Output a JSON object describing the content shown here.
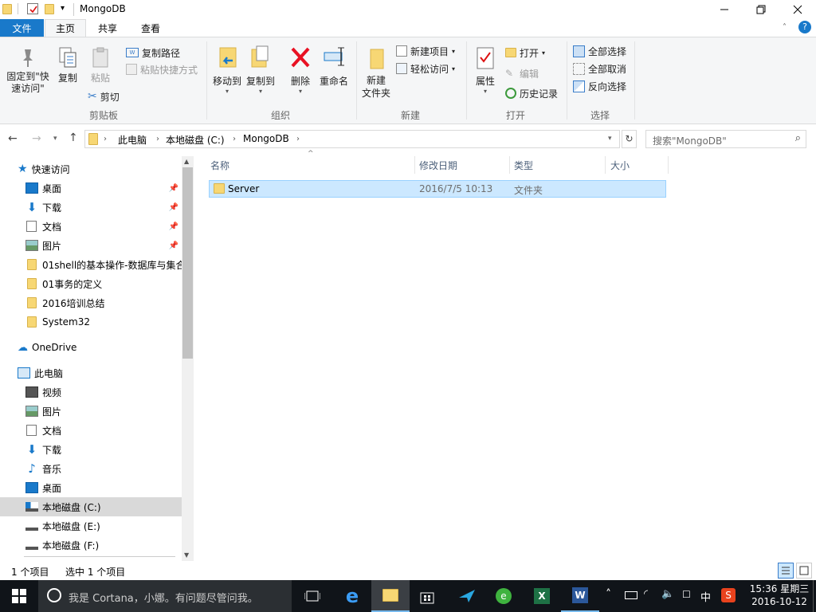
{
  "window": {
    "title": "MongoDB"
  },
  "ribbon_tabs": [
    "文件",
    "主页",
    "共享",
    "查看"
  ],
  "ribbon": {
    "clipboard": {
      "pin_label": "固定到\"快\n速访问\"",
      "copy_label": "复制",
      "paste_label": "粘贴",
      "copy_path_label": "复制路径",
      "paste_shortcut_label": "粘贴快捷方式",
      "cut_label": "剪切",
      "group_label": "剪贴板"
    },
    "organize": {
      "move_to_label": "移动到",
      "copy_to_label": "复制到",
      "delete_label": "删除",
      "rename_label": "重命名",
      "group_label": "组织"
    },
    "new": {
      "new_folder_label": "新建\n文件夹",
      "new_item_label": "新建项目",
      "easy_access_label": "轻松访问",
      "group_label": "新建"
    },
    "open": {
      "properties_label": "属性",
      "open_label": "打开",
      "edit_label": "编辑",
      "history_label": "历史记录",
      "group_label": "打开"
    },
    "select": {
      "select_all_label": "全部选择",
      "select_none_label": "全部取消",
      "invert_label": "反向选择",
      "group_label": "选择"
    }
  },
  "address": {
    "crumbs": [
      "此电脑",
      "本地磁盘 (C:)",
      "MongoDB"
    ],
    "search_placeholder": "搜索\"MongoDB\""
  },
  "nav": {
    "quick_access": "快速访问",
    "quick_items": [
      "桌面",
      "下载",
      "文档",
      "图片",
      "01shell的基本操作-数据库与集合",
      "01事务的定义",
      "2016培训总结",
      "System32"
    ],
    "onedrive": "OneDrive",
    "this_pc": "此电脑",
    "pc_items": [
      "视频",
      "图片",
      "文档",
      "下载",
      "音乐",
      "桌面",
      "本地磁盘 (C:)",
      "本地磁盘 (E:)",
      "本地磁盘 (F:)"
    ]
  },
  "columns": [
    "名称",
    "修改日期",
    "类型",
    "大小"
  ],
  "files": [
    {
      "name": "Server",
      "modified": "2016/7/5 10:13",
      "type": "文件夹",
      "size": ""
    }
  ],
  "status": {
    "count": "1 个项目",
    "selected": "选中 1 个项目"
  },
  "taskbar": {
    "cortana_placeholder": "我是 Cortana，小娜。有问题尽管问我。",
    "ime": "中",
    "time": "15:36 星期三",
    "date": "2016-10-12"
  },
  "colors": {
    "file_tab": "#1979ca",
    "selection": "#cce8ff",
    "taskbar": "#101419"
  }
}
